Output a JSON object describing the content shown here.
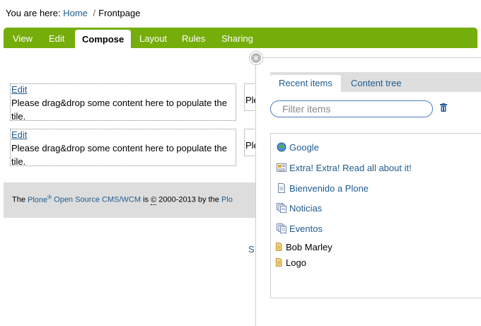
{
  "breadcrumb": {
    "prefix": "You are here:",
    "home": "Home",
    "separator": "/",
    "current": "Frontpage"
  },
  "editbar": {
    "tabs": [
      {
        "label": "View"
      },
      {
        "label": "Edit"
      },
      {
        "label": "Compose",
        "active": true
      },
      {
        "label": "Layout"
      },
      {
        "label": "Rules"
      },
      {
        "label": "Sharing"
      }
    ],
    "color": "#75ad0a"
  },
  "tiles": [
    {
      "edit_label": "Edit",
      "text": "Please drag&drop some content here to populate the tile.",
      "right_text": "Ple"
    },
    {
      "edit_label": "Edit",
      "text": "Please drag&drop some content here to populate the tile.",
      "right_text": "Ple"
    }
  ],
  "footer": {
    "the": "The",
    "plone": "Plone",
    "reg": "®",
    "cms": "Open Source CMS/WCM",
    "is": "is",
    "copy": "©",
    "years": "2000-2013 by the",
    "by": "Plo"
  },
  "stray": "S",
  "content_browser": {
    "close_icon": "close-icon",
    "tabs": [
      {
        "label": "Recent items",
        "active": true
      },
      {
        "label": "Content tree"
      }
    ],
    "filter_placeholder": "Filter items",
    "items": [
      {
        "label": "Google",
        "icon": "link-globe-icon"
      },
      {
        "label": "Extra! Extra! Read all about it!",
        "icon": "news-item-icon"
      },
      {
        "label": "Bienvenido a Plone",
        "icon": "document-icon"
      },
      {
        "label": "Noticias",
        "icon": "collection-icon"
      },
      {
        "label": "Eventos",
        "icon": "collection-icon"
      },
      {
        "label": "Bob Marley",
        "icon": "image-icon"
      },
      {
        "label": "Logo",
        "icon": "image-icon"
      }
    ]
  }
}
